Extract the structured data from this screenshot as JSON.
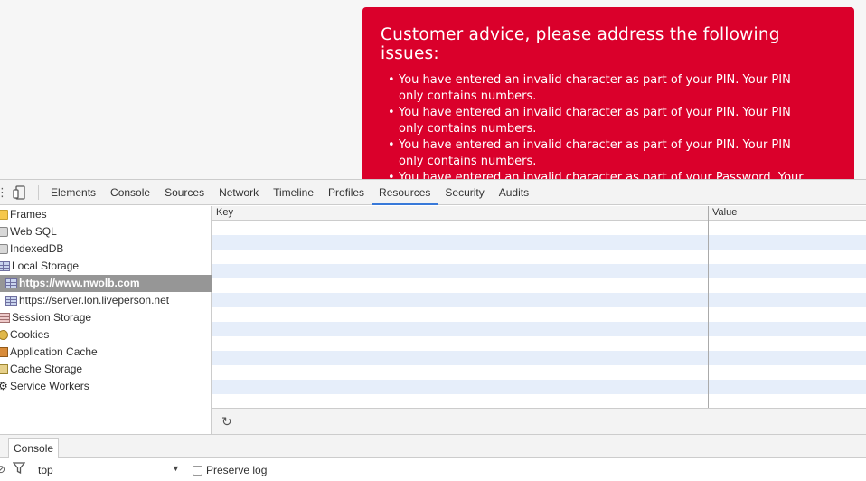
{
  "error": {
    "title": "Customer advice, please address the following issues:",
    "items": [
      "You have entered an invalid character as part of your PIN. Your PIN only contains numbers.",
      "You have entered an invalid character as part of your PIN. Your PIN only contains numbers.",
      "You have entered an invalid character as part of your PIN. Your PIN only contains numbers.",
      "You have entered an invalid character as part of your Password. Your Password will be made up of letters and/or numbers."
    ],
    "color": "#da002b"
  },
  "devtools": {
    "tabs": [
      "Elements",
      "Console",
      "Sources",
      "Network",
      "Timeline",
      "Profiles",
      "Resources",
      "Security",
      "Audits"
    ],
    "active_tab": "Resources",
    "sidebar": {
      "frames": "Frames",
      "web_sql": "Web SQL",
      "indexeddb": "IndexedDB",
      "local_storage": "Local Storage",
      "local_storage_origins": [
        "https://www.nwolb.com",
        "https://server.lon.liveperson.net"
      ],
      "session_storage": "Session Storage",
      "cookies": "Cookies",
      "app_cache": "Application Cache",
      "cache_storage": "Cache Storage",
      "service_workers": "Service Workers"
    },
    "table": {
      "key_header": "Key",
      "value_header": "Value"
    },
    "drawer": {
      "tab": "Console",
      "context": "top",
      "preserve_log": "Preserve log"
    },
    "accent": "#3879d9"
  }
}
